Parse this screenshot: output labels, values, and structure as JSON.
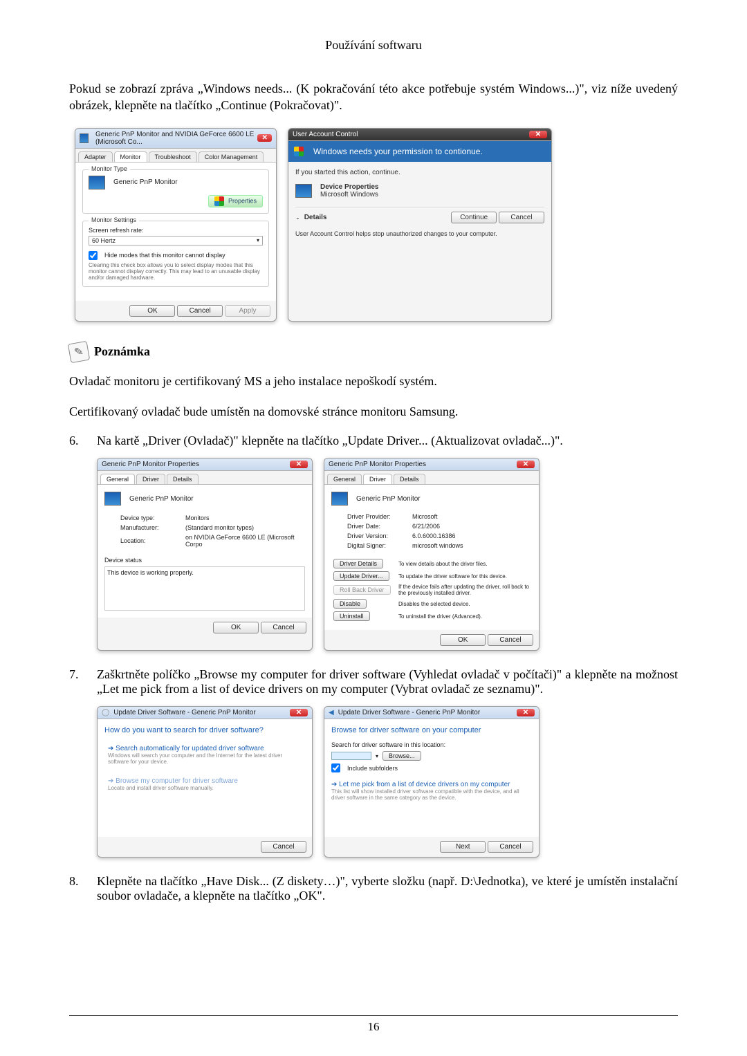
{
  "header": {
    "title": "Používání softwaru"
  },
  "intro": {
    "p1": "Pokud se zobrazí zpráva „Windows needs... (K pokračování této akce potřebuje systém Windows...)\", viz níže uvedený obrázek, klepněte na tlačítko „Continue (Pokračovat)\"."
  },
  "shot1": {
    "title": "Generic PnP Monitor and NVIDIA GeForce 6600 LE (Microsoft Co...",
    "tabs": {
      "adapter": "Adapter",
      "monitor": "Monitor",
      "troubleshoot": "Troubleshoot",
      "color": "Color Management"
    },
    "monitor_type_legend": "Monitor Type",
    "monitor_name": "Generic PnP Monitor",
    "properties_btn": "Properties",
    "settings_legend": "Monitor Settings",
    "refresh_label": "Screen refresh rate:",
    "refresh_value": "60 Hertz",
    "hide_label": "Hide modes that this monitor cannot display",
    "hide_desc": "Clearing this check box allows you to select display modes that this monitor cannot display correctly. This may lead to an unusable display and/or damaged hardware.",
    "ok": "OK",
    "cancel": "Cancel",
    "apply": "Apply"
  },
  "uac": {
    "title": "User Account Control",
    "headline": "Windows needs your permission to contionue.",
    "sub": "If you started this action, continue.",
    "item1": "Device Properties",
    "item2": "Microsoft Windows",
    "details": "Details",
    "continue": "Continue",
    "cancel": "Cancel",
    "footer": "User Account Control helps stop unauthorized changes to your computer."
  },
  "note": {
    "label": "Poznámka",
    "p1": "Ovladač monitoru je certifikovaný MS a jeho instalace nepoškodí systém.",
    "p2": "Certifikovaný ovladač bude umístěn na domovské stránce monitoru Samsung."
  },
  "step6": {
    "num": "6.",
    "text": "Na kartě „Driver (Ovladač)\" klepněte na tlačítko „Update Driver... (Aktualizovat ovladač...)\"."
  },
  "shot2a": {
    "title": "Generic PnP Monitor Properties",
    "tabs": {
      "general": "General",
      "driver": "Driver",
      "details": "Details"
    },
    "name": "Generic PnP Monitor",
    "devtype_l": "Device type:",
    "devtype_v": "Monitors",
    "manu_l": "Manufacturer:",
    "manu_v": "(Standard monitor types)",
    "loc_l": "Location:",
    "loc_v": "on NVIDIA GeForce 6600 LE (Microsoft Corpo",
    "status_legend": "Device status",
    "status_text": "This device is working properly.",
    "ok": "OK",
    "cancel": "Cancel"
  },
  "shot2b": {
    "title": "Generic PnP Monitor Properties",
    "tabs": {
      "general": "General",
      "driver": "Driver",
      "details": "Details"
    },
    "name": "Generic PnP Monitor",
    "prov_l": "Driver Provider:",
    "prov_v": "Microsoft",
    "date_l": "Driver Date:",
    "date_v": "6/21/2006",
    "ver_l": "Driver Version:",
    "ver_v": "6.0.6000.16386",
    "sign_l": "Digital Signer:",
    "sign_v": "microsoft windows",
    "bd": "Driver Details",
    "bd_t": "To view details about the driver files.",
    "bu": "Update Driver...",
    "bu_t": "To update the driver software for this device.",
    "br": "Roll Back Driver",
    "br_t": "If the device fails after updating the driver, roll back to the previously installed driver.",
    "bdi": "Disable",
    "bdi_t": "Disables the selected device.",
    "bun": "Uninstall",
    "bun_t": "To uninstall the driver (Advanced).",
    "ok": "OK",
    "cancel": "Cancel"
  },
  "step7": {
    "num": "7.",
    "text": "Zaškrtněte políčko „Browse my computer for driver software (Vyhledat ovladač v počítači)\" a klepněte na možnost „Let me pick from a list of device drivers on my computer (Vybrat ovladač ze seznamu)\"."
  },
  "shot3a": {
    "crumb": "Update Driver Software - Generic PnP Monitor",
    "heading": "How do you want to search for driver software?",
    "opt1": "Search automatically for updated driver software",
    "opt1s": "Windows will search your computer and the Internet for the latest driver software for your device.",
    "opt2": "Browse my computer for driver software",
    "opt2s": "Locate and install driver software manually.",
    "cancel": "Cancel"
  },
  "shot3b": {
    "crumb": "Update Driver Software - Generic PnP Monitor",
    "heading": "Browse for driver software on your computer",
    "loc_label": "Search for driver software in this location:",
    "browse": "Browse...",
    "include": "Include subfolders",
    "opt": "Let me pick from a list of device drivers on my computer",
    "opts": "This list will show installed driver software compatible with the device, and all driver software in the same category as the device.",
    "next": "Next",
    "cancel": "Cancel"
  },
  "step8": {
    "num": "8.",
    "text": "Klepněte na tlačítko „Have Disk... (Z diskety…)\", vyberte složku (např. D:\\Jednotka), ve které je umístěn instalační soubor ovladače, a klepněte na tlačítko „OK\"."
  },
  "page_number": "16"
}
